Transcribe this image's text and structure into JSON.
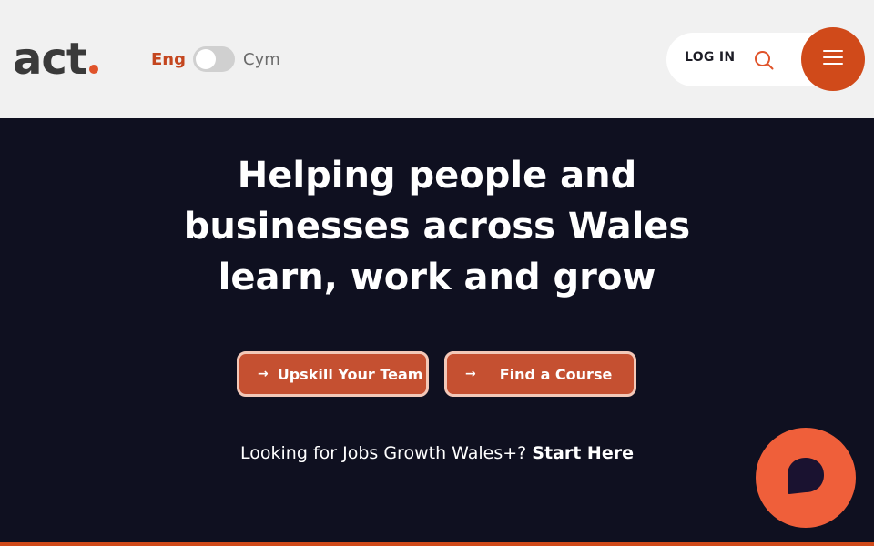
{
  "header": {
    "logo_text": "act",
    "language": {
      "active": "Eng",
      "inactive": "Cym"
    },
    "login_label": "LOG IN",
    "search_icon": "search-icon",
    "menu_icon": "hamburger-menu-icon"
  },
  "hero": {
    "title": "Helping people and businesses across Wales learn, work and grow",
    "buttons": [
      {
        "label": "Upskill Your Team",
        "icon": "arrow-right-icon"
      },
      {
        "label": "Find a Course",
        "icon": "arrow-right-icon"
      }
    ],
    "jobs_text": "Looking for Jobs Growth Wales+?",
    "jobs_link": "Start Here"
  },
  "chat": {
    "icon": "chat-bubble-icon"
  },
  "colors": {
    "accent": "#d04a1a",
    "button": "#c55031",
    "hero_bg": "#0f1020",
    "header_bg": "#f1f1f1",
    "chat": "#ef5f3a"
  }
}
